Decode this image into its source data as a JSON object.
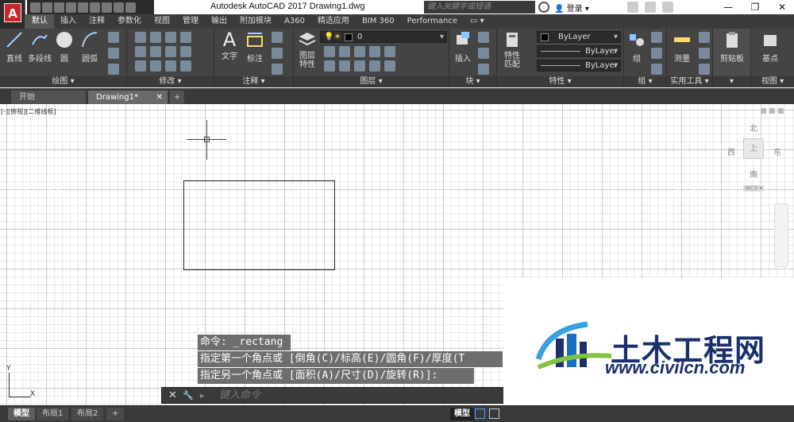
{
  "app": {
    "window_title": "Autodesk AutoCAD 2017    Drawing1.dwg",
    "search_placeholder": "键入关键字或短语",
    "login_label": "登录",
    "logo_letter": "A",
    "window_controls": [
      "—",
      "❐",
      "✕"
    ]
  },
  "ribbon_tabs": [
    {
      "label": "默认",
      "active": true
    },
    {
      "label": "插入"
    },
    {
      "label": "注释"
    },
    {
      "label": "参数化"
    },
    {
      "label": "视图"
    },
    {
      "label": "管理"
    },
    {
      "label": "输出"
    },
    {
      "label": "附加模块"
    },
    {
      "label": "A360"
    },
    {
      "label": "精选应用"
    },
    {
      "label": "BIM 360"
    },
    {
      "label": "Performance"
    },
    {
      "label": "▭ ▾"
    }
  ],
  "ribbon": {
    "draw": {
      "label": "绘图 ▾",
      "line": "直线",
      "polyline": "多段线",
      "circle": "圆",
      "arc": "圆弧"
    },
    "modify": {
      "label": "修改 ▾"
    },
    "annotation": {
      "label": "注释 ▾",
      "text": "文字",
      "dimension": "标注",
      "text_glyph": "A"
    },
    "layers": {
      "label": "图层 ▾",
      "layer_properties": "图层\n特性",
      "current_layer": "0"
    },
    "block": {
      "label": "块 ▾",
      "insert": "插入"
    },
    "properties": {
      "label": "特性 ▾",
      "match": "特性\n匹配",
      "color": "ByLayer",
      "linetype": "ByLayer",
      "lineweight": "ByLayer"
    },
    "groups": {
      "label": "组 ▾",
      "group": "组"
    },
    "utilities": {
      "label": "实用工具 ▾",
      "measure": "测量"
    },
    "clipboard": {
      "label": "▾",
      "clipboard": "剪贴板"
    },
    "view": {
      "label": "视图 ▾",
      "base": "基点"
    }
  },
  "doc_tabs": [
    {
      "label": "开始"
    },
    {
      "label": "Drawing1*",
      "active": true
    }
  ],
  "doc_tab_close": "✕",
  "doc_tab_add": "+",
  "viewport": {
    "label": "[-][俯视][二维线框]",
    "viewcube": {
      "north": "北",
      "south": "南",
      "east": "东",
      "west": "西",
      "top_face": "上",
      "wcs": "WCS ▾"
    }
  },
  "ucs": {
    "x": "X",
    "y": "Y"
  },
  "command_history": [
    "命令: _rectang",
    "指定第一个角点或 [倒角(C)/标高(E)/圆角(F)/厚度(T",
    "指定另一个角点或 [面积(A)/尺寸(D)/旋转(R)]:"
  ],
  "command_input": {
    "placeholder": "键入命令",
    "close": "✕",
    "settings": "🔧",
    "prompt_icon": "▸"
  },
  "watermark": {
    "title": "土木工程网",
    "url": "www.civilcn.com"
  },
  "status_bar": {
    "layout_tabs": [
      {
        "label": "模型",
        "active": true
      },
      {
        "label": "布局1"
      },
      {
        "label": "布局2"
      }
    ],
    "add_layout": "+",
    "model_button": "模型"
  }
}
